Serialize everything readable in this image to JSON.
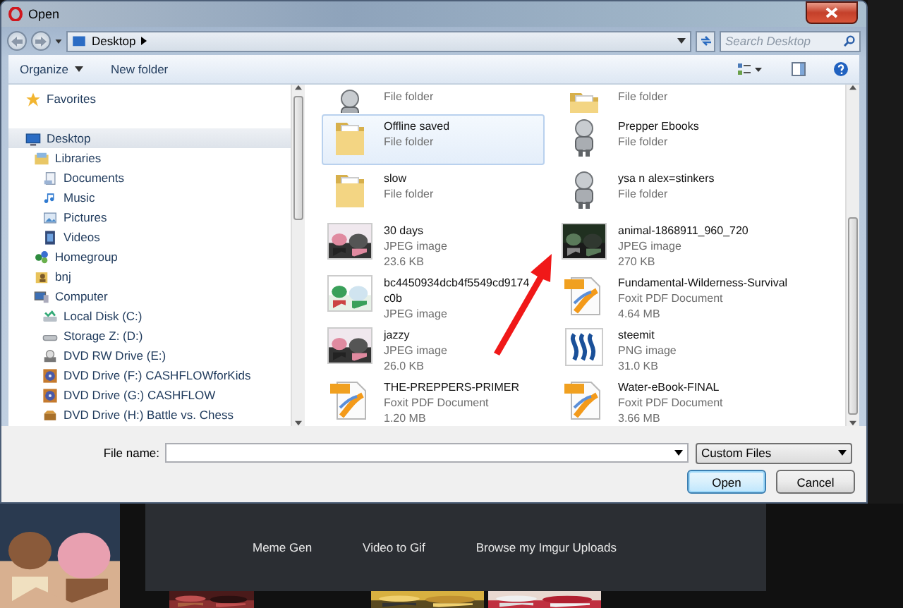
{
  "window": {
    "title": "Open"
  },
  "address_bar": {
    "path": "Desktop",
    "search": {
      "placeholder": "Search Desktop"
    }
  },
  "toolbar": {
    "buttons": [
      {
        "label": "Organize",
        "dropdown": true
      },
      {
        "label": "New folder",
        "dropdown": false
      }
    ]
  },
  "navigation": [
    {
      "label": "Favorites",
      "kind": "star",
      "selected": false
    },
    {
      "label": "Desktop",
      "kind": "monitor",
      "selected": true,
      "children": [
        {
          "label": "Libraries",
          "kind": "library",
          "selected": false,
          "children": [
            {
              "label": "Documents",
              "kind": "doc",
              "selected": false
            },
            {
              "label": "Music",
              "kind": "note",
              "selected": false
            },
            {
              "label": "Pictures",
              "selected": false
            },
            {
              "label": "Videos",
              "kind": "film",
              "selected": false
            }
          ]
        },
        {
          "label": "Homegroup",
          "kind": "network",
          "selected": false
        },
        {
          "label": "bnj",
          "kind": "user",
          "selected": false
        },
        {
          "label": "Computer",
          "kind": "computer",
          "selected": false,
          "children": [
            {
              "label": "Local Disk (C:)",
              "kind": "disk",
              "selected": false
            },
            {
              "label": "Storage Z: (D:)",
              "kind": "hdd",
              "selected": false
            },
            {
              "label": "DVD RW Drive (E:)",
              "kind": "dvd",
              "selected": false
            },
            {
              "label": "DVD Drive (F:) CASHFLOWforKids",
              "kind": "art",
              "selected": false
            },
            {
              "label": "DVD Drive (G:) CASHFLOW",
              "kind": "art",
              "selected": false
            },
            {
              "label": "DVD Drive (H:) Battle vs. Chess",
              "kind": "chest",
              "selected": false
            }
          ]
        }
      ]
    }
  ],
  "files": [
    {
      "type": "File folder",
      "kind": "figure",
      "selected": false
    },
    {
      "type": "File folder",
      "kind": "folder",
      "selected": false
    },
    {
      "name": "Offline saved",
      "type": "File folder",
      "kind": "folder",
      "selected": true
    },
    {
      "name": "Prepper Ebooks",
      "type": "File folder",
      "kind": "figure",
      "selected": false
    },
    {
      "name": "slow",
      "type": "File folder",
      "kind": "folder",
      "selected": false
    },
    {
      "name": "ysa n alex=stinkers",
      "type": "File folder",
      "kind": "figure",
      "selected": false
    },
    {
      "name": "30 days",
      "type": "JPEG image",
      "size": "23.6 KB",
      "selected": false
    },
    {
      "name": "animal-1868911_960_720",
      "type": "JPEG image",
      "size": "270 KB",
      "selected": false
    },
    {
      "name": "bc4450934dcb4f5549cd9174",
      "name_end": "c0b",
      "type": "JPEG image",
      "selected": false
    },
    {
      "name": "Fundamental-Wilderness-Survival",
      "type": "Foxit PDF Document",
      "size": "4.64 MB",
      "kind": "pdf",
      "selected": false
    },
    {
      "name": "jazzy",
      "type": "JPEG image",
      "size": "26.0 KB",
      "selected": false
    },
    {
      "name": "steemit",
      "type": "PNG image",
      "size": "31.0 KB",
      "kind": "logo",
      "selected": false
    },
    {
      "name": "THE-PREPPERS-PRIMER",
      "type": "Foxit PDF Document",
      "size": "1.20 MB",
      "kind": "pdf",
      "selected": false
    },
    {
      "name": "Water-eBook-FINAL",
      "type": "Foxit PDF Document",
      "size": "3.66 MB",
      "kind": "pdf",
      "selected": false
    }
  ],
  "footer": {
    "file_name_label": "File name:",
    "file_type": "Custom Files",
    "buttons": [
      {
        "label": "Open",
        "default": true
      },
      {
        "label": "Cancel",
        "default": false
      }
    ]
  },
  "page_links": [
    "Meme Gen",
    "Video to Gif",
    "Browse my Imgur Uploads"
  ]
}
